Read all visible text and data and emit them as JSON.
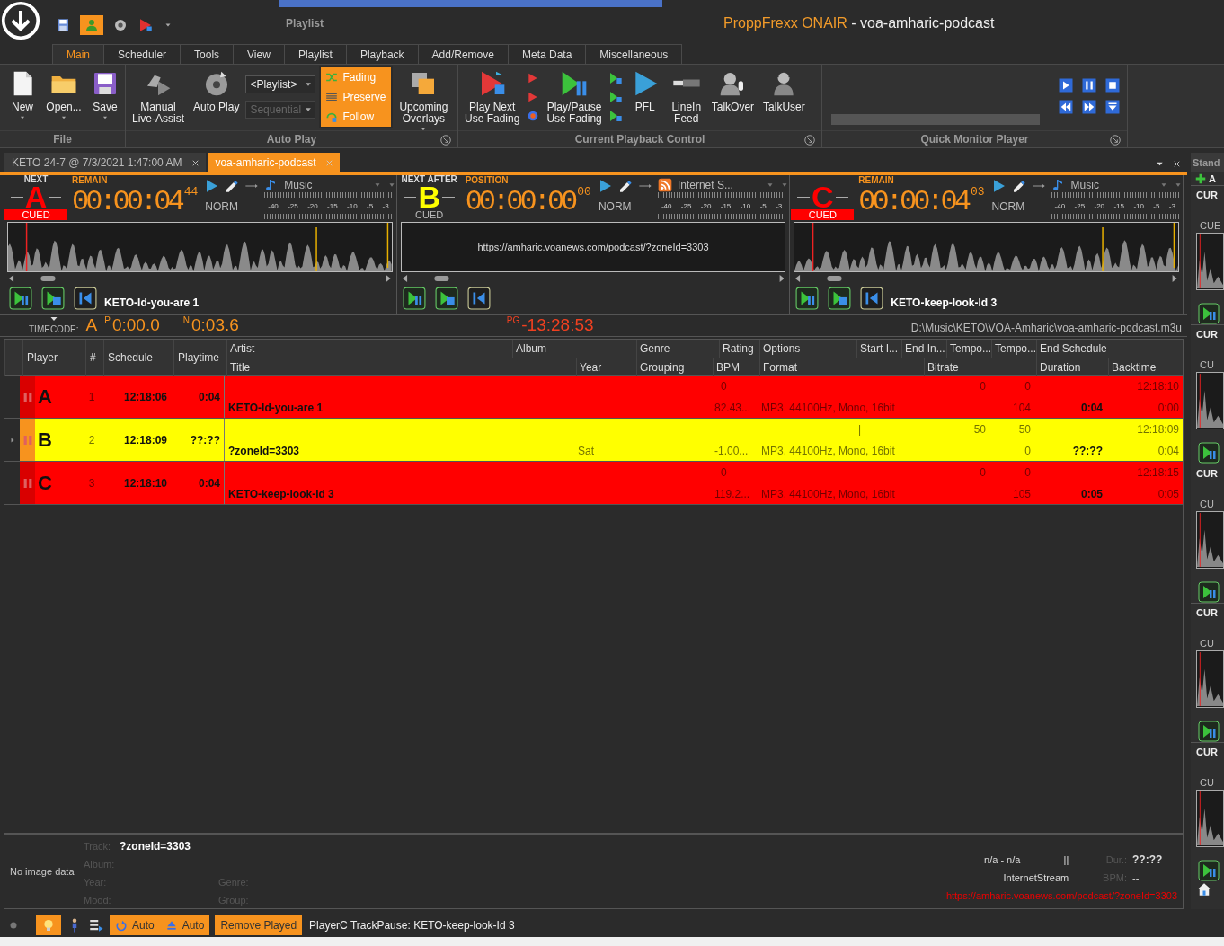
{
  "title_bar": {
    "context_tab": "Playlist",
    "app_name": "ProppFrexx ONAIR",
    "document_title": " - voa-amharic-podcast"
  },
  "ribbon_tabs": [
    {
      "label": "Main",
      "selected": true
    },
    {
      "label": "Scheduler",
      "selected": false
    },
    {
      "label": "Tools",
      "selected": false
    },
    {
      "label": "View",
      "selected": false
    },
    {
      "label": "Playlist",
      "selected": false
    },
    {
      "label": "Playback",
      "selected": false
    },
    {
      "label": "Add/Remove",
      "selected": false
    },
    {
      "label": "Meta Data",
      "selected": false
    },
    {
      "label": "Miscellaneous",
      "selected": false
    }
  ],
  "ribbon_groups": [
    {
      "title": "File",
      "launcher": false,
      "items": [
        {
          "kind": "large",
          "lines": [
            "New"
          ],
          "dropdown": true
        },
        {
          "kind": "large",
          "lines": [
            "Open..."
          ],
          "dropdown": true
        },
        {
          "kind": "large",
          "lines": [
            "Save"
          ],
          "dropdown": true
        }
      ]
    },
    {
      "title": "Auto Play",
      "launcher": true,
      "items": [
        {
          "kind": "large",
          "lines": [
            "Manual",
            "Live-Assist"
          ],
          "dropdown": false
        },
        {
          "kind": "large",
          "lines": [
            "Auto Play"
          ],
          "dropdown": false
        },
        {
          "kind": "combos",
          "combos": [
            {
              "value": "<Playlist>",
              "disabled": false
            },
            {
              "value": "Sequential",
              "disabled": true
            }
          ]
        },
        {
          "kind": "toggles",
          "toggles": [
            {
              "label": "Fading",
              "on": true
            },
            {
              "label": "Preserve",
              "on": true
            },
            {
              "label": "Follow",
              "on": true
            }
          ]
        },
        {
          "kind": "large",
          "lines": [
            "Upcoming",
            "Overlays"
          ],
          "dropdown": true
        }
      ]
    },
    {
      "title": "Current Playback Control",
      "launcher": true,
      "items": [
        {
          "kind": "large",
          "lines": [
            "Play Next",
            "Use Fading"
          ],
          "dropdown": false
        },
        {
          "kind": "small"
        },
        {
          "kind": "large",
          "lines": [
            "Play/Pause",
            "Use Fading"
          ],
          "dropdown": false
        },
        {
          "kind": "small"
        },
        {
          "kind": "large",
          "lines": [
            "PFL"
          ],
          "dropdown": false
        },
        {
          "kind": "large",
          "lines": [
            "LineIn",
            "Feed"
          ],
          "dropdown": false
        },
        {
          "kind": "large",
          "lines": [
            "TalkOver"
          ],
          "dropdown": false
        },
        {
          "kind": "large",
          "lines": [
            "TalkUser"
          ],
          "dropdown": false
        }
      ]
    },
    {
      "title": "Quick Monitor Player",
      "launcher": true,
      "items": [
        {
          "kind": "monitor",
          "level": 0
        },
        {
          "kind": "transport"
        }
      ]
    }
  ],
  "doc_tabs": [
    {
      "label": "KETO 24-7 @ 7/3/2021 1:47:00 AM",
      "selected": false
    },
    {
      "label": "voa-amharic-podcast",
      "selected": true
    }
  ],
  "players": [
    {
      "caption": "NEXT",
      "letter": "A",
      "color": "#ff0000",
      "cued_bar": true,
      "cued": "CUED",
      "time_label": "REMAIN",
      "time": "00:00:04",
      "frames": "44",
      "mode": "NORM",
      "source": {
        "kind": "music",
        "label": "Music"
      },
      "scale": [
        "-40",
        "-25",
        "-20",
        "-15",
        "-10",
        "-5",
        "-3"
      ],
      "display": {
        "kind": "waveform"
      },
      "track": "KETO-Id-you-are 1"
    },
    {
      "caption": "NEXT AFTER",
      "letter": "B",
      "color": "#ffff00",
      "cued_bar": false,
      "cued": "CUED",
      "time_label": "POSITION",
      "time": "00:00:00",
      "frames": "00",
      "mode": "NORM",
      "source": {
        "kind": "stream",
        "label": "Internet S..."
      },
      "scale": [
        "-40",
        "-25",
        "-20",
        "-15",
        "-10",
        "-5",
        "-3"
      ],
      "display": {
        "kind": "url",
        "url": "https://amharic.voanews.com/podcast/?zoneId=3303"
      }
    },
    {
      "letter": "C",
      "color": "#ff0000",
      "cued_bar": true,
      "cued": "CUED",
      "time_label": "REMAIN",
      "time": "00:00:04",
      "frames": "03",
      "mode": "NORM",
      "source": {
        "kind": "music",
        "label": "Music"
      },
      "scale": [
        "-40",
        "-25",
        "-20",
        "-15",
        "-10",
        "-5",
        "-3"
      ],
      "display": {
        "kind": "waveform"
      },
      "track": "KETO-keep-look-Id 3"
    }
  ],
  "info_line": {
    "timecode_label": "TIMECODE:",
    "player": "A",
    "position": "$^{P}$0:00.0",
    "next": "$^{N}$0:03.6",
    "program": "$^{PG}$-13:28:53",
    "path": "D:\\Music\\KETO\\VOA-Amharic\\voa-amharic-podcast.m3u"
  },
  "playlist": {
    "fixed_columns": [
      "Player",
      "#",
      "Schedule",
      "Playtime"
    ],
    "columns_top": [
      "Artist",
      "Album",
      "Genre",
      "Rating",
      "Options",
      "Start I...",
      "End In...",
      "Tempo...",
      "Tempo...",
      "End Schedule"
    ],
    "columns_bottom": [
      "Title",
      "Year",
      "Grouping",
      "BPM",
      "Format",
      "Bitrate",
      "Duration",
      "Backtime"
    ],
    "rows": [
      {
        "player": "A",
        "number": "1",
        "schedule": "12:18:06",
        "playtime": "0:04",
        "color": "#ff0000",
        "selected": false,
        "rating": "0",
        "tempo_1": "0",
        "tempo_2": "0",
        "end_schedule": "12:18:10",
        "title": "KETO-Id-you-are 1",
        "bpm": "82.43...",
        "format": "MP3, 44100Hz, Mono, 16bit",
        "bitrate": "104",
        "duration": "0:04",
        "backtime": "0:00"
      },
      {
        "player": "B",
        "number": "2",
        "schedule": "12:18:09",
        "playtime": "??:??",
        "color": "#ffff00",
        "selected": true,
        "start_intro": "|",
        "tempo_1": "50",
        "tempo_2": "50",
        "end_schedule": "12:18:09",
        "title": "?zoneId=3303",
        "year": "Sat",
        "bpm": "-1.00...",
        "format": "MP3, 44100Hz, Mono, 16bit",
        "bitrate": "0",
        "duration": "??:??",
        "backtime": "0:04"
      },
      {
        "player": "C",
        "number": "3",
        "schedule": "12:18:10",
        "playtime": "0:04",
        "color": "#ff0000",
        "selected": false,
        "rating": "0",
        "tempo_1": "0",
        "tempo_2": "0",
        "end_schedule": "12:18:15",
        "title": "KETO-keep-look-Id 3",
        "bpm": "119.2...",
        "format": "MP3, 44100Hz, Mono, 16bit",
        "bitrate": "105",
        "duration": "0:05",
        "backtime": "0:05"
      }
    ]
  },
  "track_info": {
    "no_image": "No image data",
    "fields": [
      {
        "label": "Track:",
        "value": "?zoneId=3303"
      },
      {
        "label": "Album:"
      },
      {
        "label": "Year:",
        "label_2": "Genre:"
      },
      {
        "label": "Mood:",
        "label_2": "Group:"
      }
    ],
    "range": "n/a - n/a",
    "pause_mark": "||",
    "duration_label": "Dur.:",
    "duration": "??:??",
    "source": "InternetStream",
    "bpm_label": "BPM:",
    "bpm": "--",
    "url": "https://amharic.voanews.com/podcast/?zoneId=3303"
  },
  "status_bar": {
    "auto_1": "Auto",
    "auto_2": "Auto",
    "remove_played": "Remove Played",
    "message": "PlayerC TrackPause: KETO-keep-look-Id 3"
  },
  "sidebar": {
    "title": "Stand",
    "add": "A",
    "slots": [
      {
        "label": "CUR",
        "cue": "CUE"
      },
      {
        "label": "CUR",
        "cue": "CU"
      },
      {
        "label": "CUR",
        "cue": "CU"
      },
      {
        "label": "CUR",
        "cue": "CU"
      },
      {
        "label": "CUR",
        "cue": "CU"
      }
    ]
  }
}
